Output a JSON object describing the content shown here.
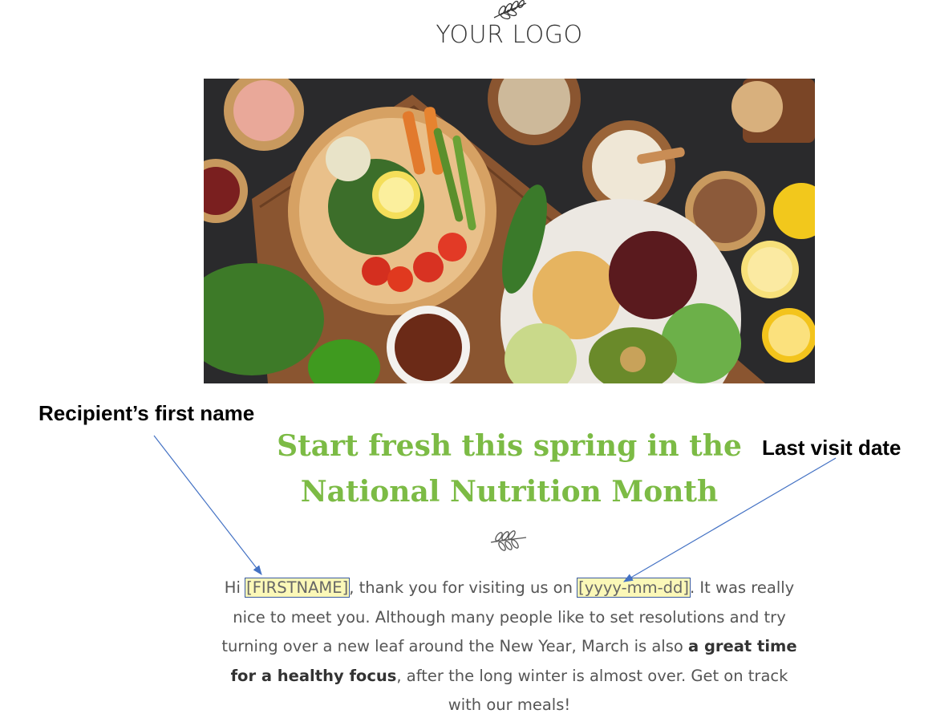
{
  "logo": {
    "text": "YOUR LOGO",
    "icon": "leaf-branch-icon"
  },
  "hero_image": {
    "description_icon": "food-bowls-image"
  },
  "annotations": {
    "first_name_label": "Recipient’s first name",
    "last_visit_label": "Last visit date"
  },
  "headline": {
    "line1": "Start fresh this spring in the",
    "line2": "National Nutrition Month"
  },
  "divider": {
    "icon": "leaf-branch-icon"
  },
  "body": {
    "hi": "Hi",
    "firstname_token": "[FIRSTNAME]",
    "after_name": ", thank you for visiting us on",
    "date_token": "[yyyy-mm-dd]",
    "after_date": ". It was really nice to meet you. Although many people like to set resolutions and try turning over a new leaf around the New Year, March is also",
    "bold_phrase": "a great time for a healthy focus",
    "ending": ", after the long winter is almost over. Get on track with our meals!"
  },
  "colors": {
    "headline_green": "#7cbb45",
    "token_highlight": "#fbf8b8",
    "token_border": "#3b5ba0",
    "arrow_blue": "#4472c4"
  }
}
